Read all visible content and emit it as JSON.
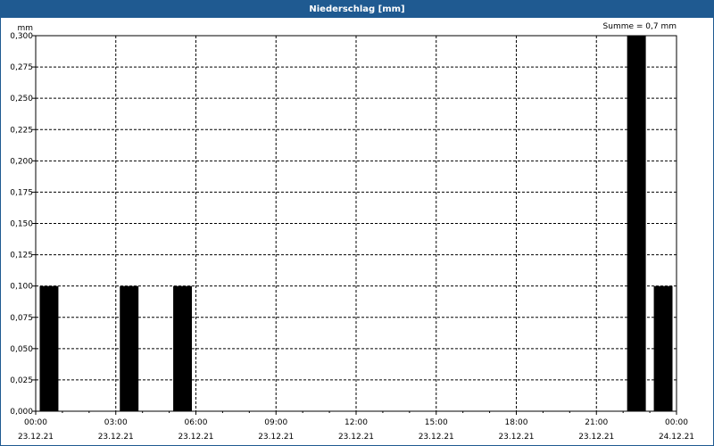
{
  "window": {
    "title": "Niederschlag [mm]"
  },
  "summary": "Summe = 0,7 mm",
  "chart_data": {
    "type": "bar",
    "title": "Niederschlag [mm]",
    "ylabel": "mm",
    "ylim": [
      0,
      0.3
    ],
    "grid": true,
    "y_ticks": [
      "0,000",
      "0,025",
      "0,050",
      "0,075",
      "0,100",
      "0,125",
      "0,150",
      "0,175",
      "0,200",
      "0,225",
      "0,250",
      "0,275",
      "0,300"
    ],
    "x_ticks": [
      {
        "time": "00:00",
        "date": "23.12.21"
      },
      {
        "time": "03:00",
        "date": "23.12.21"
      },
      {
        "time": "06:00",
        "date": "23.12.21"
      },
      {
        "time": "09:00",
        "date": "23.12.21"
      },
      {
        "time": "12:00",
        "date": "23.12.21"
      },
      {
        "time": "15:00",
        "date": "23.12.21"
      },
      {
        "time": "18:00",
        "date": "23.12.21"
      },
      {
        "time": "21:00",
        "date": "23.12.21"
      },
      {
        "time": "00:00",
        "date": "24.12.21"
      }
    ],
    "bars": [
      {
        "start": "00:00",
        "end": "01:00",
        "value": 0.1
      },
      {
        "start": "03:00",
        "end": "04:00",
        "value": 0.1
      },
      {
        "start": "05:00",
        "end": "06:00",
        "value": 0.1
      },
      {
        "start": "22:00",
        "end": "23:00",
        "value": 0.3
      },
      {
        "start": "23:00",
        "end": "24:00",
        "value": 0.1
      }
    ],
    "bar_color": "#000000",
    "grid_color": "#000000"
  }
}
